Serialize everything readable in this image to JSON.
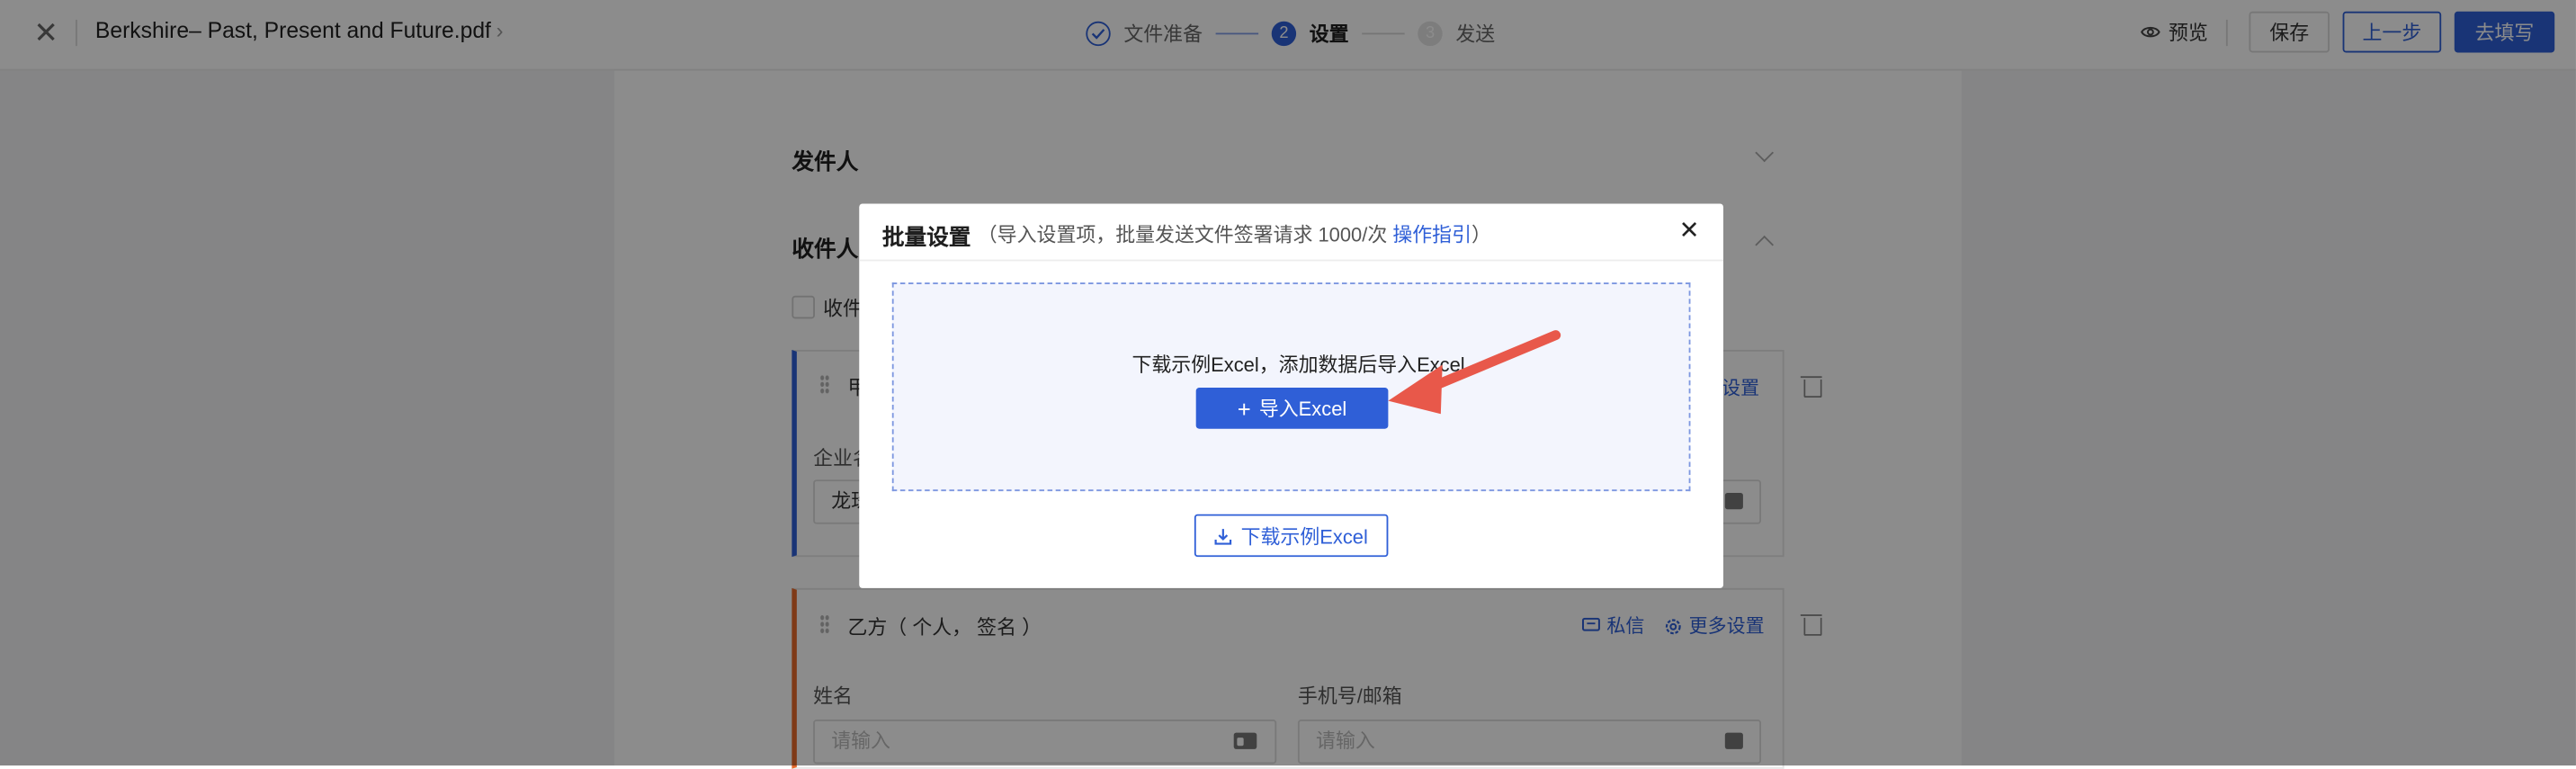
{
  "topbar": {
    "doc_title": "Berkshire– Past, Present and Future.pdf",
    "steps": [
      {
        "num": "✓",
        "label": "文件准备"
      },
      {
        "num": "2",
        "label": "设置"
      },
      {
        "num": "3",
        "label": "发送"
      }
    ],
    "preview_label": "预览",
    "save_label": "保存",
    "prev_label": "上一步",
    "next_label": "去填写"
  },
  "page": {
    "sender_title": "发件人",
    "recipient_title": "收件人",
    "checkbox_label": "收件",
    "card_a": {
      "role_text": "甲",
      "settings_text": "设置",
      "company_label": "企业名",
      "company_value": "龙珠"
    },
    "card_b": {
      "role_text": "乙方（ 个人， 签名 ）",
      "message_label": "私信",
      "more_settings_label": "更多设置",
      "name_label": "姓名",
      "name_placeholder": "请输入",
      "contact_label": "手机号/邮箱",
      "contact_placeholder": "请输入"
    }
  },
  "modal": {
    "title": "批量设置",
    "subtitle_prefix": "（导入设置项，批量发送文件签署请求 1000/次 ",
    "subtitle_link": "操作指引",
    "subtitle_suffix": "）",
    "drop_hint": "下载示例Excel，添加数据后导入Excel",
    "import_label": "导入Excel",
    "download_label": "下载示例Excel"
  },
  "colors": {
    "primary": "#2f5fd7",
    "accent_orange": "#e86a2a",
    "arrow": "#e8584a"
  }
}
